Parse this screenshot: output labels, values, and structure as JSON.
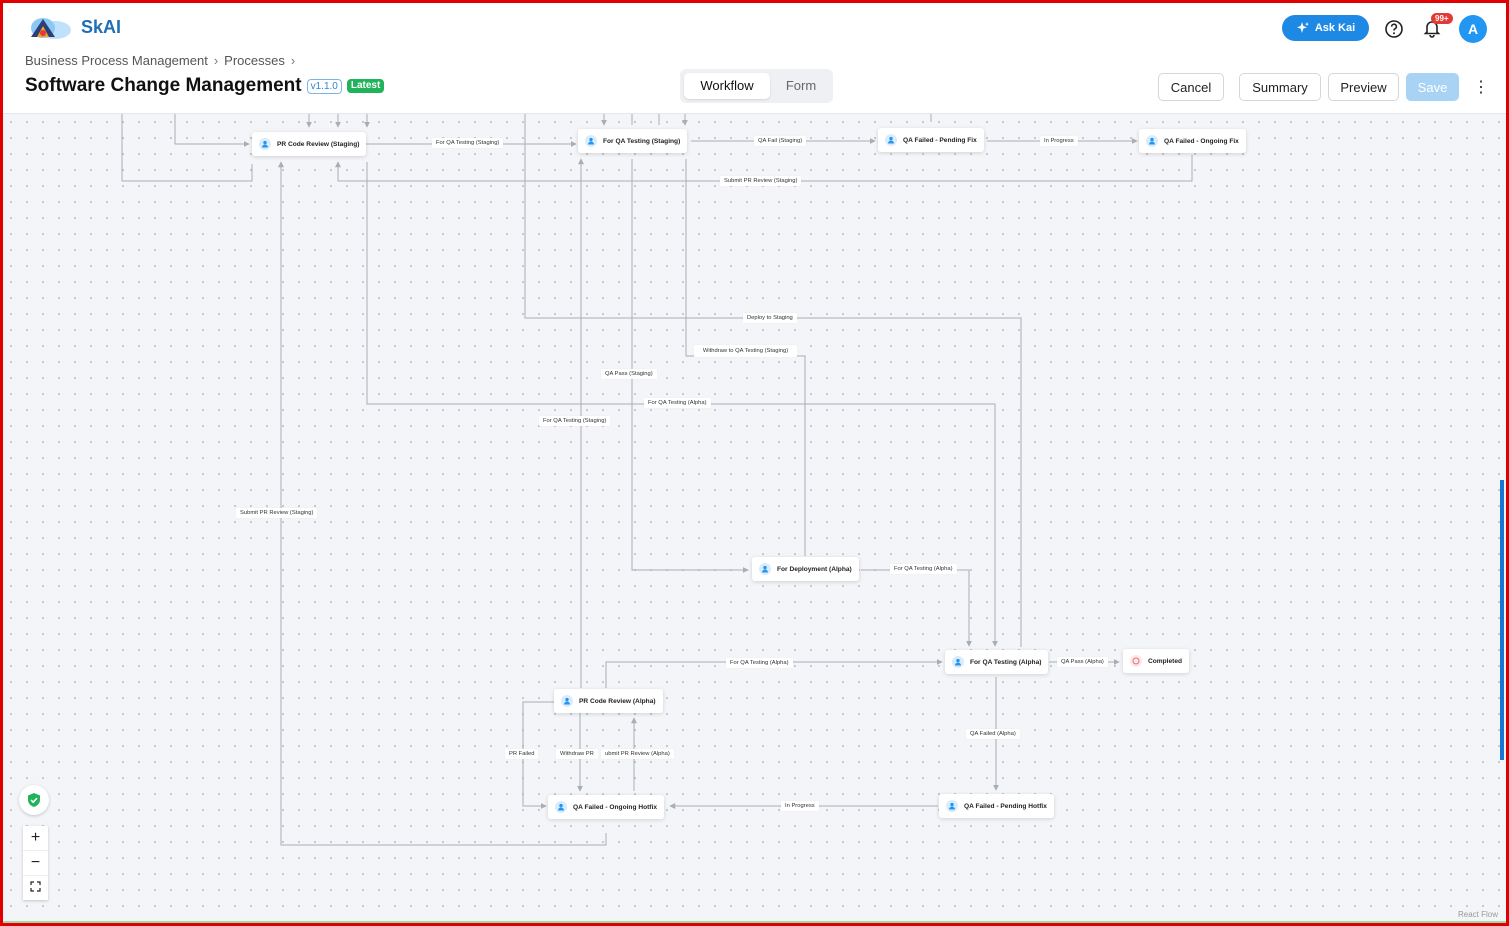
{
  "app": {
    "name": "SkAI"
  },
  "header": {
    "ask_kai": "Ask Kai",
    "notifications_count": "99+",
    "avatar_initial": "A"
  },
  "breadcrumbs": [
    "Business Process Management",
    "Processes"
  ],
  "page": {
    "title": "Software Change Management",
    "version": "v1.1.0",
    "latest_badge": "Latest"
  },
  "view_toggle": {
    "workflow": "Workflow",
    "form": "Form",
    "active": "Workflow"
  },
  "actions": {
    "cancel": "Cancel",
    "summary": "Summary",
    "preview": "Preview",
    "save": "Save"
  },
  "nodes": {
    "pr_code_review_staging": "PR Code Review (Staging)",
    "for_qa_testing_staging": "For QA Testing (Staging)",
    "qa_failed_pending_fix": "QA Failed - Pending Fix",
    "qa_failed_ongoing_fix": "QA Failed - Ongoing Fix",
    "for_deployment_alpha": "For Deployment (Alpha)",
    "for_qa_testing_alpha": "For QA Testing (Alpha)",
    "completed": "Completed",
    "pr_code_review_alpha": "PR Code Review (Alpha)",
    "qa_failed_ongoing_hotfix": "QA Failed - Ongoing Hotfix",
    "qa_failed_pending_hotfix": "QA Failed - Pending Hotfix"
  },
  "edge_labels": {
    "for_qa_testing_staging_1": "For QA Testing (Staging)",
    "qa_fail_staging": "QA Fail (Staging)",
    "in_progress_1": "In Progress",
    "submit_pr_review_staging_1": "Submit PR Review (Staging)",
    "deploy_to_staging": "Deploy to Staging",
    "withdraw_to_qa_testing_staging": "Withdraw to QA Testing (Staging)",
    "qa_pass_staging": "QA Pass (Staging)",
    "for_qa_testing_alpha_1": "For QA Testing (Alpha)",
    "for_qa_testing_staging_2": "For QA Testing (Staging)",
    "submit_pr_review_staging_2": "Submit PR Review (Staging)",
    "for_qa_testing_alpha_2": "For QA Testing (Alpha)",
    "for_qa_testing_alpha_3": "For QA Testing (Alpha)",
    "qa_pass_alpha": "QA Pass (Alpha)",
    "qa_failed_alpha": "QA Failed (Alpha)",
    "pr_failed": "PR Failed",
    "withdraw_pr": "Withdraw PR",
    "submit_pr_review_alpha": "ubmit PR Review (Alpha)",
    "in_progress_2": "In Progress"
  },
  "canvas": {
    "attribution": "React Flow"
  },
  "colors": {
    "accent": "#1e88e5",
    "latest": "#22b35a",
    "edge": "#a8adb6",
    "canvas_bg": "#f4f5f8"
  }
}
